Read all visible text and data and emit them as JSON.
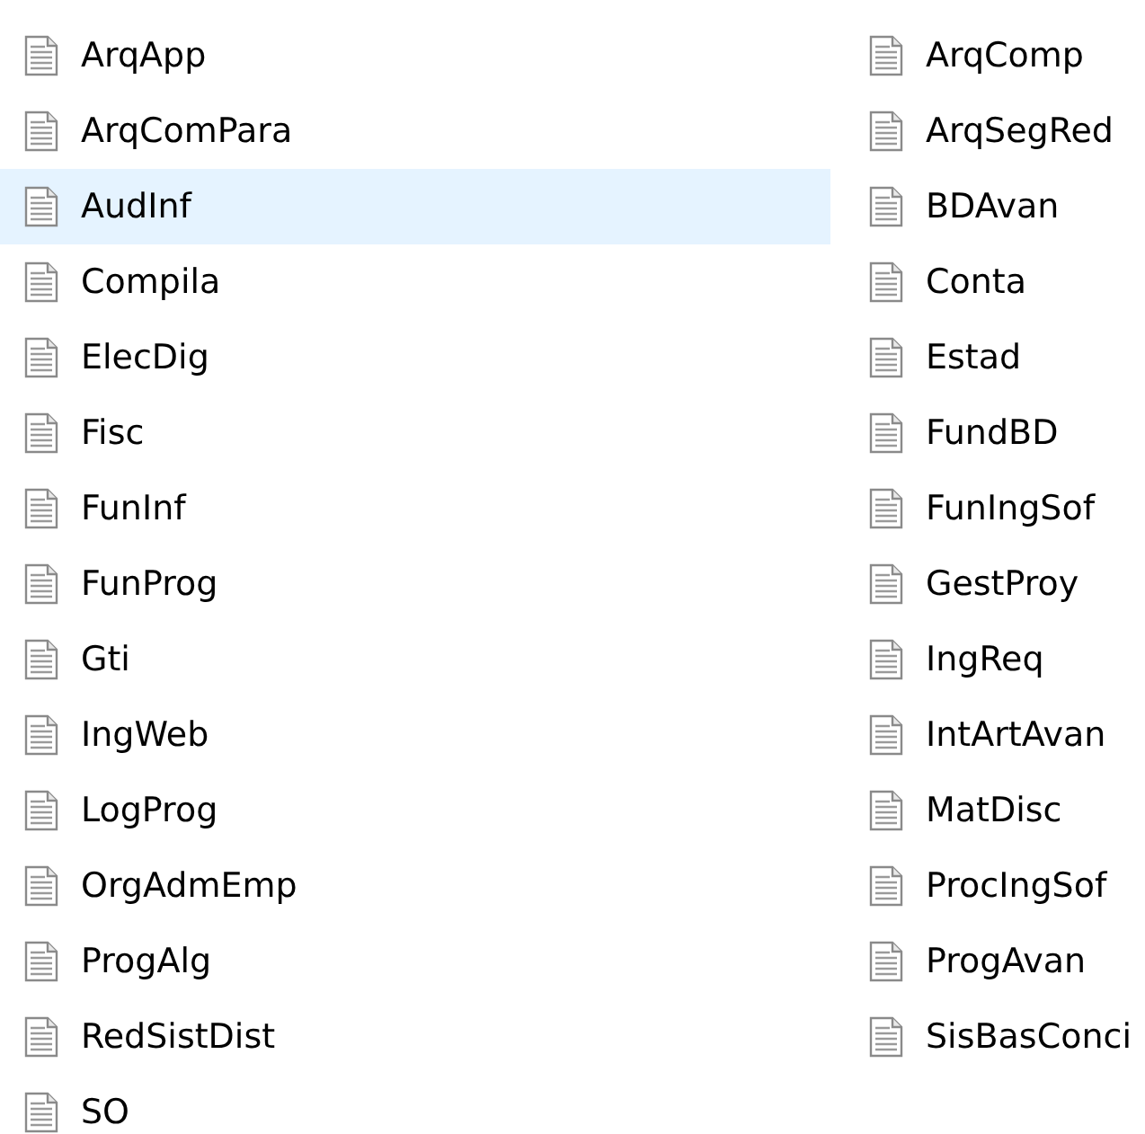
{
  "files": [
    {
      "name": "ArqApp",
      "selected": false
    },
    {
      "name": "ArqComPara",
      "selected": false
    },
    {
      "name": "AudInf",
      "selected": true
    },
    {
      "name": "Compila",
      "selected": false
    },
    {
      "name": "ElecDig",
      "selected": false
    },
    {
      "name": "Fisc",
      "selected": false
    },
    {
      "name": "FunInf",
      "selected": false
    },
    {
      "name": "FunProg",
      "selected": false
    },
    {
      "name": "Gti",
      "selected": false
    },
    {
      "name": "IngWeb",
      "selected": false
    },
    {
      "name": "LogProg",
      "selected": false
    },
    {
      "name": "OrgAdmEmp",
      "selected": false
    },
    {
      "name": "ProgAlg",
      "selected": false
    },
    {
      "name": "RedSistDist",
      "selected": false
    },
    {
      "name": "SO",
      "selected": false
    },
    {
      "name": "ArqComp",
      "selected": false
    },
    {
      "name": "ArqSegRed",
      "selected": false
    },
    {
      "name": "BDAvan",
      "selected": false
    },
    {
      "name": "Conta",
      "selected": false
    },
    {
      "name": "Estad",
      "selected": false
    },
    {
      "name": "FundBD",
      "selected": false
    },
    {
      "name": "FunIngSof",
      "selected": false
    },
    {
      "name": "GestProy",
      "selected": false
    },
    {
      "name": "IngReq",
      "selected": false
    },
    {
      "name": "IntArtAvan",
      "selected": false
    },
    {
      "name": "MatDisc",
      "selected": false
    },
    {
      "name": "ProcIngSof",
      "selected": false
    },
    {
      "name": "ProgAvan",
      "selected": false
    },
    {
      "name": "SisBasConci",
      "selected": false
    }
  ]
}
